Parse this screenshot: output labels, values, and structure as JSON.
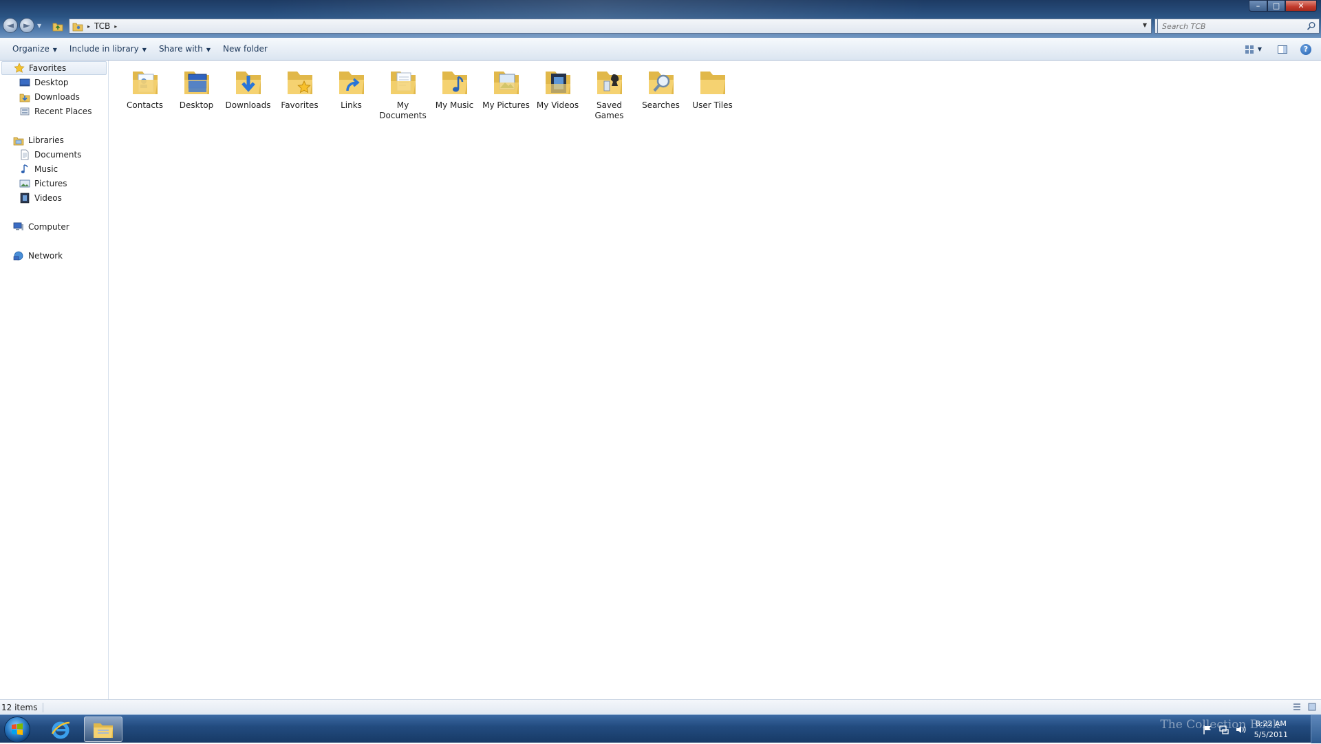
{
  "window": {
    "controls": {
      "minimize": "–",
      "maximize": "□",
      "close": "✕"
    }
  },
  "navigation": {
    "back": "◄",
    "forward": "►",
    "recent_drop": "▼"
  },
  "address": {
    "crumbs": [
      "TCB"
    ],
    "separator": "▸",
    "dropdown": "▼",
    "refresh": "⟳"
  },
  "search": {
    "placeholder": "Search TCB"
  },
  "toolbar": {
    "organize": "Organize",
    "include_in_library": "Include in library",
    "share_with": "Share with",
    "new_folder": "New folder",
    "caret": "▼",
    "view_caret": "▼",
    "help": "?"
  },
  "sidebar": {
    "groups": [
      {
        "label": "Favorites",
        "icon": "star-icon",
        "items": [
          {
            "label": "Desktop",
            "icon": "desktop-icon"
          },
          {
            "label": "Downloads",
            "icon": "downloads-icon"
          },
          {
            "label": "Recent Places",
            "icon": "recent-places-icon"
          }
        ]
      },
      {
        "label": "Libraries",
        "icon": "libraries-icon",
        "items": [
          {
            "label": "Documents",
            "icon": "documents-icon"
          },
          {
            "label": "Music",
            "icon": "music-icon"
          },
          {
            "label": "Pictures",
            "icon": "pictures-icon"
          },
          {
            "label": "Videos",
            "icon": "videos-icon"
          }
        ]
      },
      {
        "label": "Computer",
        "icon": "computer-icon",
        "items": []
      },
      {
        "label": "Network",
        "icon": "network-icon",
        "items": []
      }
    ]
  },
  "folders": [
    {
      "name": "Contacts",
      "overlay": "contacts-icon"
    },
    {
      "name": "Desktop",
      "overlay": "desktop-icon"
    },
    {
      "name": "Downloads",
      "overlay": "download-arrow-icon"
    },
    {
      "name": "Favorites",
      "overlay": "star-icon"
    },
    {
      "name": "Links",
      "overlay": "link-arrow-icon"
    },
    {
      "name": "My Documents",
      "overlay": "document-icon"
    },
    {
      "name": "My Music",
      "overlay": "music-note-icon"
    },
    {
      "name": "My Pictures",
      "overlay": "picture-icon"
    },
    {
      "name": "My Videos",
      "overlay": "film-icon"
    },
    {
      "name": "Saved Games",
      "overlay": "chess-piece-icon"
    },
    {
      "name": "Searches",
      "overlay": "magnifier-icon"
    },
    {
      "name": "User Tiles",
      "overlay": "none"
    }
  ],
  "status": {
    "item_count": "12 items"
  },
  "taskbar": {
    "apps": [
      "internet-explorer-icon",
      "windows-explorer-icon"
    ],
    "clock_time": "8:22 AM",
    "clock_date": "5/5/2011",
    "watermark": "The Collection Book"
  },
  "colors": {
    "titlebar": "#2b5484",
    "commandbar": "#dbe5f1",
    "taskbar": "#234c80",
    "folder": "#f3cf6a",
    "link_text": "#1e395b"
  }
}
